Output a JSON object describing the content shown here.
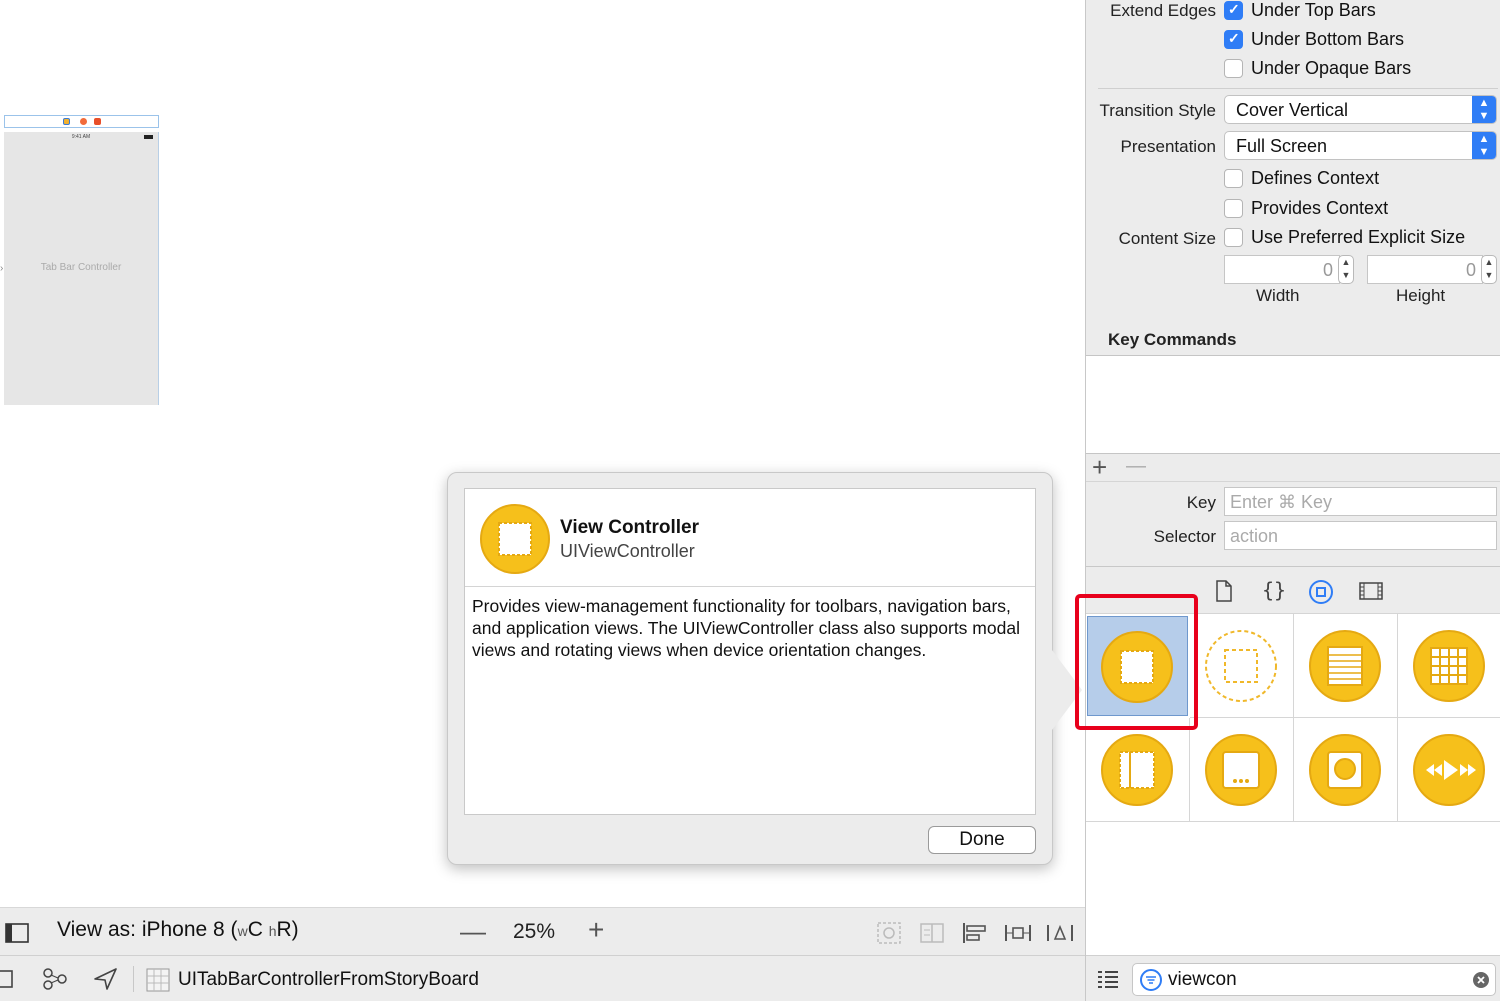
{
  "canvas": {
    "scene_label": "Tab Bar Controller",
    "scene_status_time": "9:41 AM"
  },
  "popover": {
    "title": "View Controller",
    "class_name": "UIViewController",
    "description": "Provides view-management functionality for toolbars, navigation bars, and application views. The UIViewController class also supports modal views and rotating views when device orientation changes.",
    "done_label": "Done"
  },
  "bottom_bar": {
    "view_as_prefix": "View as: iPhone 8 (",
    "size_class_w": "w",
    "size_class_c": "C",
    "size_class_h": "h",
    "size_class_r": "R)",
    "zoom_minus": "—",
    "zoom": "25%",
    "zoom_plus": "+"
  },
  "breadcrumb": {
    "file": "UITabBarControllerFromStoryBoard"
  },
  "inspector": {
    "extend_edges_label": "Extend Edges",
    "under_top_bars": "Under Top Bars",
    "under_top_bars_checked": true,
    "under_bottom_bars": "Under Bottom Bars",
    "under_bottom_bars_checked": true,
    "under_opaque_bars": "Under Opaque Bars",
    "under_opaque_bars_checked": false,
    "transition_style_label": "Transition Style",
    "transition_style_value": "Cover Vertical",
    "presentation_label": "Presentation",
    "presentation_value": "Full Screen",
    "defines_context": "Defines Context",
    "provides_context": "Provides Context",
    "content_size_label": "Content Size",
    "use_preferred_explicit_size": "Use Preferred Explicit Size",
    "width_value": "0",
    "height_value": "0",
    "width_label": "Width",
    "height_label": "Height",
    "key_commands_title": "Key Commands",
    "add_button": "+",
    "remove_button": "—",
    "key_label": "Key",
    "key_placeholder": "Enter ⌘ Key",
    "selector_label": "Selector",
    "selector_placeholder": "action"
  },
  "library": {
    "tabs": [
      "file-template-icon",
      "code-snippet-icon",
      "object-library-icon",
      "media-library-icon"
    ],
    "active_tab": "object-library-icon",
    "items": [
      "view-controller-icon",
      "storyboard-reference-icon",
      "table-view-controller-icon",
      "collection-view-controller-icon",
      "split-view-controller-icon",
      "page-view-controller-icon",
      "glkit-view-controller-icon",
      "avkit-player-view-controller-icon"
    ],
    "selected_item": "view-controller-icon",
    "search_value": "viewcon"
  },
  "colors": {
    "accent": "#2f7df6",
    "icon_gold": "#f6c01b",
    "highlight_red": "#e8001c",
    "selection": "#b6cdea"
  }
}
